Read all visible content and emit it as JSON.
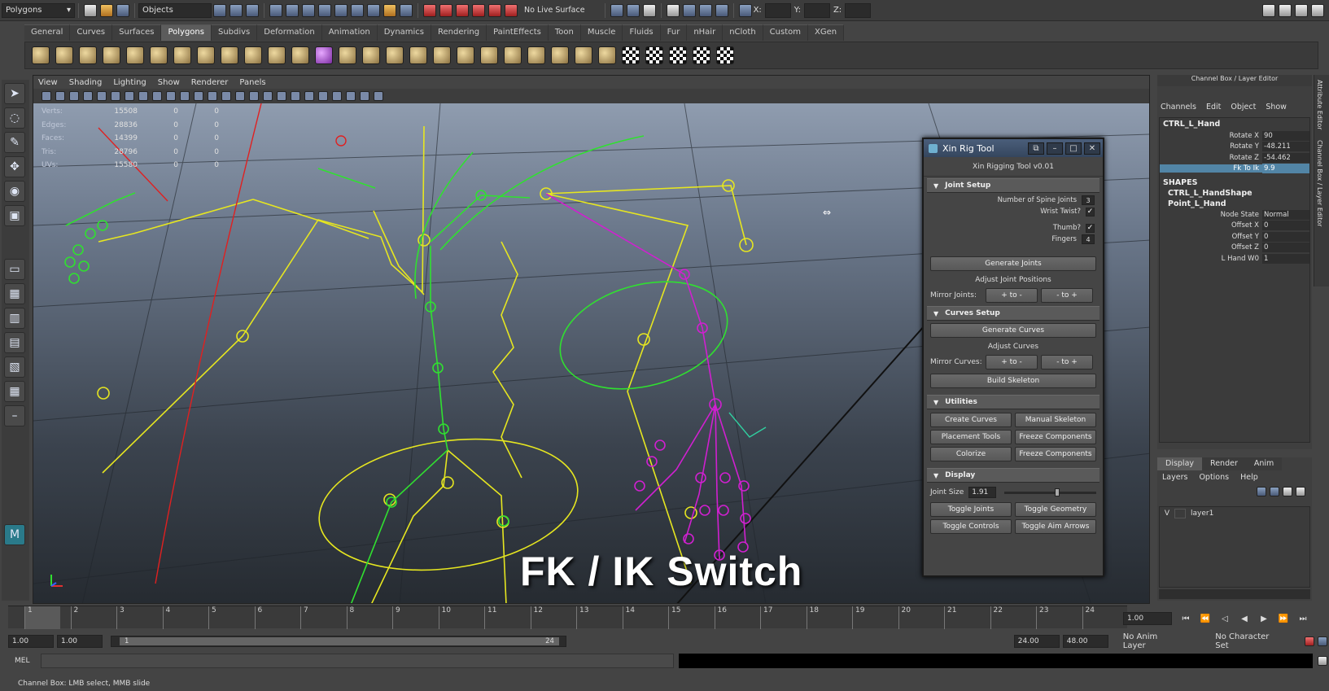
{
  "topbar": {
    "menu_set": "Polygons",
    "selection_mode": "Objects",
    "live_surface": "No Live Surface",
    "x_label": "X:",
    "y_label": "Y:",
    "z_label": "Z:"
  },
  "shelf_tabs": [
    "General",
    "Curves",
    "Surfaces",
    "Polygons",
    "Subdivs",
    "Deformation",
    "Animation",
    "Dynamics",
    "Rendering",
    "PaintEffects",
    "Toon",
    "Muscle",
    "Fluids",
    "Fur",
    "nHair",
    "nCloth",
    "Custom",
    "XGen"
  ],
  "viewport": {
    "menu": [
      "View",
      "Shading",
      "Lighting",
      "Show",
      "Renderer",
      "Panels"
    ],
    "stats": [
      {
        "label": "Verts:",
        "value": "15508",
        "a": "0",
        "b": "0"
      },
      {
        "label": "Edges:",
        "value": "28836",
        "a": "0",
        "b": "0"
      },
      {
        "label": "Faces:",
        "value": "14399",
        "a": "0",
        "b": "0"
      },
      {
        "label": "Tris:",
        "value": "28796",
        "a": "0",
        "b": "0"
      },
      {
        "label": "UVs:",
        "value": "15580",
        "a": "0",
        "b": "0"
      }
    ],
    "caption": "FK / IK Switch"
  },
  "rig_tool": {
    "title": "Xin Rig Tool",
    "header": "Xin Rigging Tool v0.01",
    "joint_setup": "Joint Setup",
    "spine_joints_label": "Number of Spine Joints",
    "spine_joints_value": "3",
    "wrist_twist_label": "Wrist Twist?",
    "thumb_label": "Thumb?",
    "fingers_label": "Fingers",
    "fingers_value": "4",
    "generate_joints": "Generate Joints",
    "adjust_joint_positions": "Adjust Joint Positions",
    "mirror_joints_label": "Mirror Joints:",
    "mirror_plus": "+ to -",
    "mirror_minus": "- to +",
    "curves_setup": "Curves Setup",
    "generate_curves": "Generate Curves",
    "adjust_curves": "Adjust Curves",
    "mirror_curves_label": "Mirror Curves:",
    "build_skeleton": "Build Skeleton",
    "utilities": "Utilities",
    "create_curves": "Create Curves",
    "manual_skeleton": "Manual Skeleton",
    "placement_tools": "Placement Tools",
    "freeze_components": "Freeze Components",
    "colorize": "Colorize",
    "display": "Display",
    "joint_size_label": "Joint Size",
    "joint_size_value": "1.91",
    "joint_size_fraction": 0.55,
    "toggle_joints": "Toggle Joints",
    "toggle_geometry": "Toggle Geometry",
    "toggle_controls": "Toggle Controls",
    "toggle_aim_arrows": "Toggle Aim Arrows"
  },
  "channel_box": {
    "title": "Channel Box / Layer Editor",
    "menu": [
      "Channels",
      "Edit",
      "Object",
      "Show"
    ],
    "object": "CTRL_L_Hand",
    "attrs": [
      {
        "k": "Rotate X",
        "v": "90"
      },
      {
        "k": "Rotate Y",
        "v": "-48.211"
      },
      {
        "k": "Rotate Z",
        "v": "-54.462"
      },
      {
        "k": "Fk To Ik",
        "v": "9.9"
      }
    ],
    "shapes_label": "SHAPES",
    "shape1": "CTRL_L_HandShape",
    "shape2": "Point_L_Hand",
    "shape_attrs": [
      {
        "k": "Node State",
        "v": "Normal"
      },
      {
        "k": "Offset X",
        "v": "0"
      },
      {
        "k": "Offset Y",
        "v": "0"
      },
      {
        "k": "Offset Z",
        "v": "0"
      },
      {
        "k": "L Hand W0",
        "v": "1"
      }
    ],
    "side_tab1": "Attribute Editor",
    "side_tab2": "Channel Box / Layer Editor"
  },
  "layer_editor": {
    "tabs": [
      "Display",
      "Render",
      "Anim"
    ],
    "menu": [
      "Layers",
      "Options",
      "Help"
    ],
    "layer_visible": "V",
    "layer_name": "layer1"
  },
  "timeline": {
    "ticks": [
      "1",
      "2",
      "3",
      "4",
      "5",
      "6",
      "7",
      "8",
      "9",
      "10",
      "11",
      "12",
      "13",
      "14",
      "15",
      "16",
      "17",
      "18",
      "19",
      "20",
      "21",
      "22",
      "23",
      "24"
    ],
    "current_frame": "1.00"
  },
  "range": {
    "start": "1.00",
    "playback_start": "1.00",
    "bar_start": "1",
    "bar_end": "24",
    "playback_end": "24.00",
    "end": "48.00",
    "anim_layer": "No Anim Layer",
    "character_set": "No Character Set"
  },
  "mel": {
    "label": "MEL"
  },
  "helpline": "Channel Box: LMB select, MMB slide"
}
